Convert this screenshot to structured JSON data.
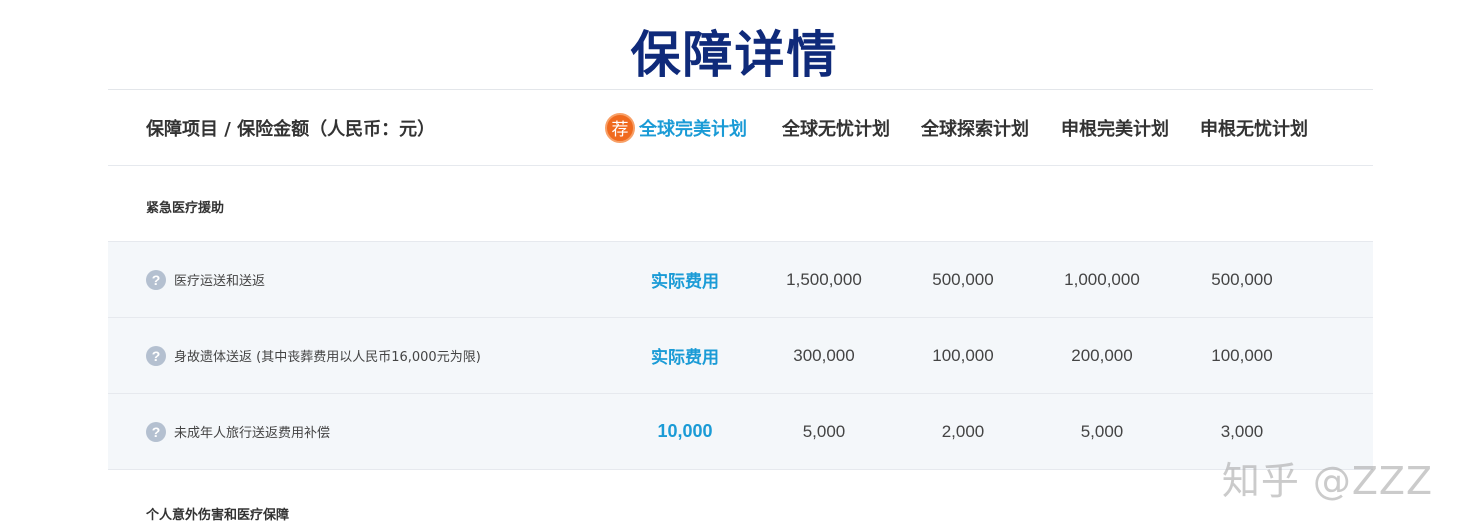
{
  "page": {
    "title": "保障详情"
  },
  "header": {
    "label": "保障项目 / 保险金额（人民币：元）",
    "badge": "荐",
    "plans": [
      "全球完美计划",
      "全球无忧计划",
      "全球探索计划",
      "申根完美计划",
      "申根无忧计划"
    ]
  },
  "sections": [
    {
      "title": "紧急医疗援助",
      "items": [
        {
          "label": "医疗运送和送返",
          "values": [
            "实际费用",
            "1,500,000",
            "500,000",
            "1,000,000",
            "500,000"
          ]
        },
        {
          "label": "身故遗体送返 (其中丧葬费用以人民币16,000元为限)",
          "values": [
            "实际费用",
            "300,000",
            "100,000",
            "200,000",
            "100,000"
          ]
        },
        {
          "label": "未成年人旅行送返费用补偿",
          "values": [
            "10,000",
            "5,000",
            "2,000",
            "5,000",
            "3,000"
          ]
        }
      ]
    },
    {
      "title": "个人意外伤害和医疗保障",
      "items": []
    }
  ],
  "help_icon_glyph": "?",
  "colors": {
    "title": "#0f2a7a",
    "accent": "#1a9bd6",
    "badge": "#f06a1e",
    "row_bg": "#f4f7fa"
  },
  "watermark": "知乎 @ZZZ"
}
